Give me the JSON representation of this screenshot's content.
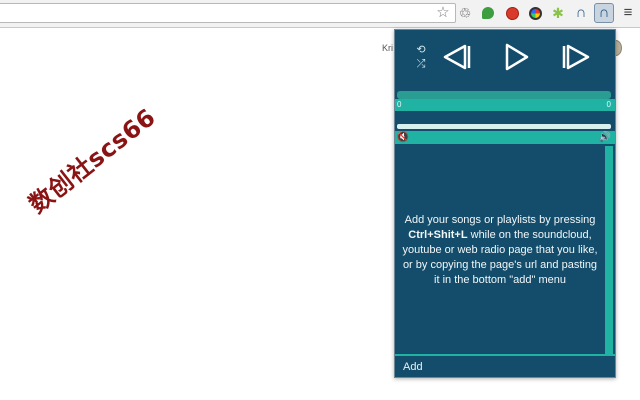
{
  "toolbar": {
    "icons": [
      "star-icon",
      "recycle-icon",
      "evernote-icon",
      "stop-icon",
      "color-wheel-icon",
      "android-icon",
      "headphones-icon",
      "headphones-active-icon",
      "menu-icon"
    ],
    "glyphs": {
      "star": "☆",
      "recycle": "♲",
      "android": "✱",
      "headphones": "∩",
      "menu": "≡"
    }
  },
  "page": {
    "watermark": "数创社scs66",
    "user_text": "Kri"
  },
  "player": {
    "repeat_glyph": "⟲",
    "shuffle_glyph": "⤮",
    "time_current": "0",
    "time_total": "0",
    "mute_glyph": "🔇",
    "volume_glyph": "🔊",
    "instructions": {
      "part1": "Add your songs or playlists by pressing ",
      "shortcut": "Ctrl+Shit+L",
      "part2": " while on the soundcloud, youtube or web radio page that you like, or by copying the page's url and pasting it in the bottom \"add\" menu"
    },
    "add_label": "Add",
    "colors": {
      "background": "#134d6b",
      "accent": "#20b2a3"
    }
  }
}
